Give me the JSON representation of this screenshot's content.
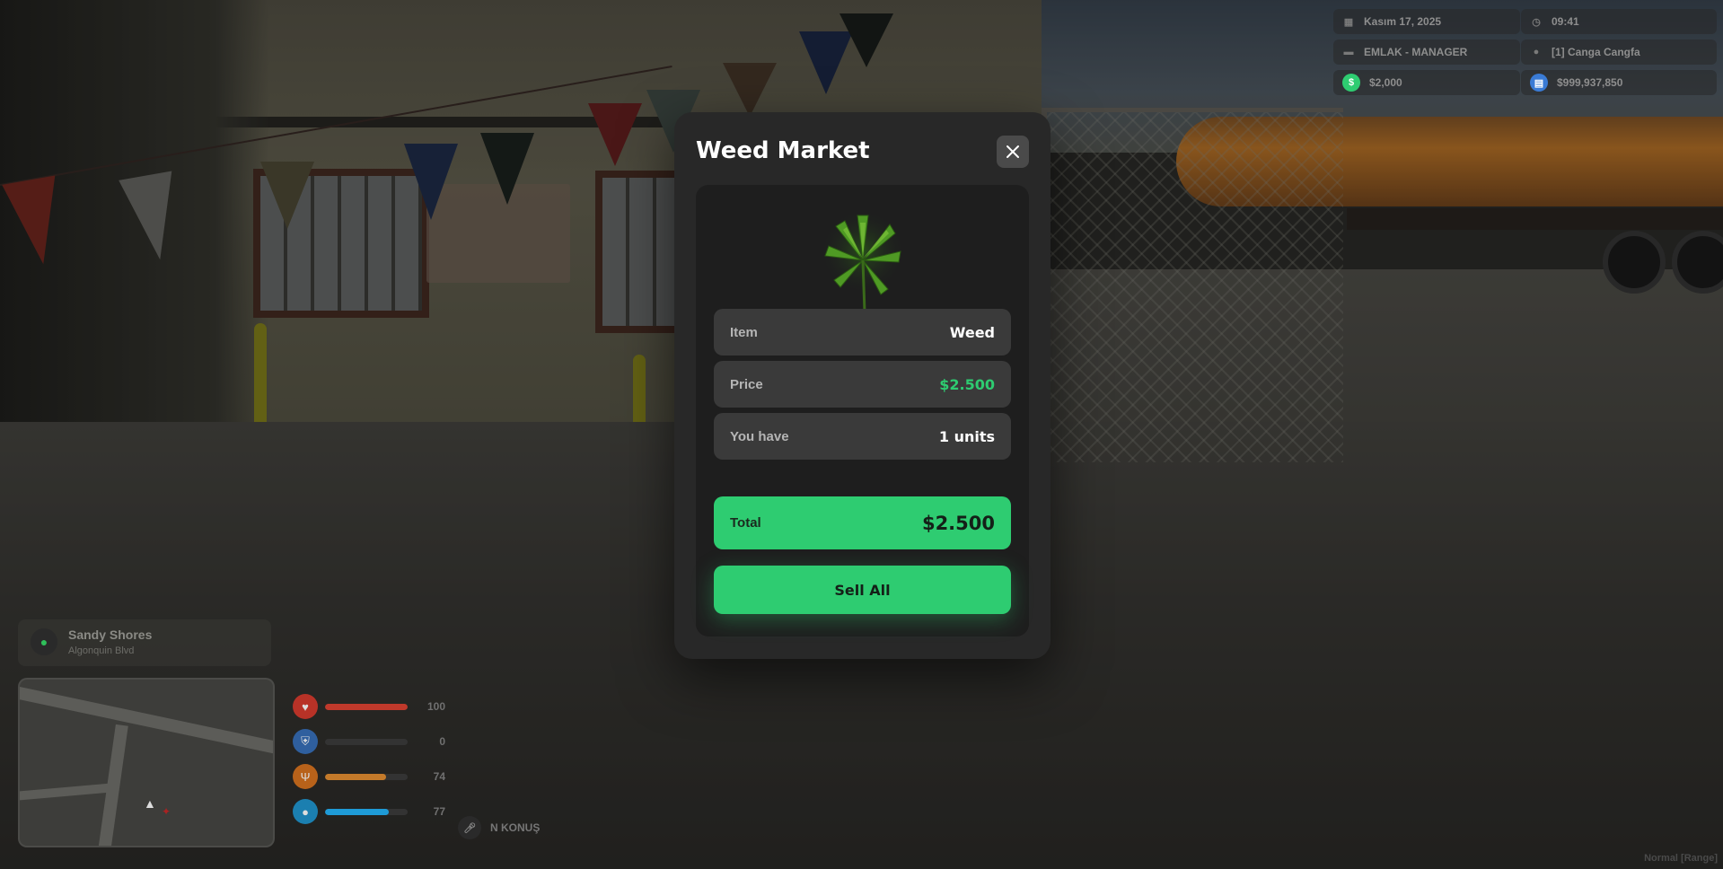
{
  "hud_top": {
    "date": "Kasım 17, 2025",
    "time": "09:41",
    "job": "EMLAK - MANAGER",
    "player": "[1] Canga Cangfa",
    "cash": "$2,000",
    "bank": "$999,937,850",
    "cash_color": "#2ecc71",
    "bank_color": "#3a7bd5"
  },
  "location": {
    "street": "Sandy Shores",
    "sub_street": "Algonquin Blvd"
  },
  "status": {
    "health": {
      "value": "100",
      "level": 100,
      "color": "#e74c3c"
    },
    "armor": {
      "value": "0",
      "level": 0,
      "color": "#3a7bd5"
    },
    "hunger": {
      "value": "74",
      "level": 74,
      "color": "#e67e22"
    },
    "thirst": {
      "value": "77",
      "level": 77,
      "color": "#1e9bd7"
    }
  },
  "voice": {
    "label": "N KONUŞ"
  },
  "mode_text": "Normal [Range]",
  "modal": {
    "title": "Weed Market",
    "item_label": "Item",
    "item_value": "Weed",
    "price_label": "Price",
    "price_value": "$2.500",
    "have_label": "You have",
    "have_value": "1 units",
    "total_label": "Total",
    "total_value": "$2.500",
    "sell_button": "Sell All",
    "accent_color": "#2ecc71"
  }
}
